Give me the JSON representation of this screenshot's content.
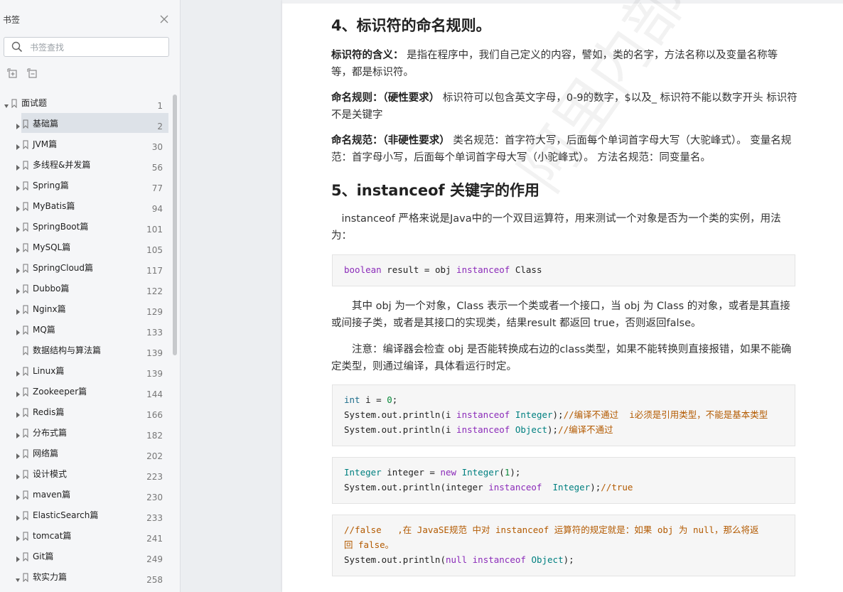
{
  "sidebar": {
    "title": "书签",
    "search": {
      "placeholder": "书签查找",
      "value": ""
    },
    "tree": [
      {
        "label": "面试题",
        "page": "1",
        "level": 0,
        "arrow": "expanded",
        "selected": false
      },
      {
        "label": "基础篇",
        "page": "2",
        "level": 1,
        "arrow": "collapsed",
        "selected": true
      },
      {
        "label": "JVM篇",
        "page": "30",
        "level": 1,
        "arrow": "collapsed",
        "selected": false
      },
      {
        "label": "多线程&并发篇",
        "page": "56",
        "level": 1,
        "arrow": "collapsed",
        "selected": false
      },
      {
        "label": "Spring篇",
        "page": "77",
        "level": 1,
        "arrow": "collapsed",
        "selected": false
      },
      {
        "label": "MyBatis篇",
        "page": "94",
        "level": 1,
        "arrow": "collapsed",
        "selected": false
      },
      {
        "label": "SpringBoot篇",
        "page": "101",
        "level": 1,
        "arrow": "collapsed",
        "selected": false
      },
      {
        "label": "MySQL篇",
        "page": "105",
        "level": 1,
        "arrow": "collapsed",
        "selected": false
      },
      {
        "label": "SpringCloud篇",
        "page": "117",
        "level": 1,
        "arrow": "collapsed",
        "selected": false
      },
      {
        "label": "Dubbo篇",
        "page": "122",
        "level": 1,
        "arrow": "collapsed",
        "selected": false
      },
      {
        "label": "Nginx篇",
        "page": "129",
        "level": 1,
        "arrow": "collapsed",
        "selected": false
      },
      {
        "label": "MQ篇",
        "page": "133",
        "level": 1,
        "arrow": "collapsed",
        "selected": false
      },
      {
        "label": "数据结构与算法篇",
        "page": "139",
        "level": 1,
        "arrow": "none",
        "selected": false
      },
      {
        "label": "Linux篇",
        "page": "139",
        "level": 1,
        "arrow": "collapsed",
        "selected": false
      },
      {
        "label": "Zookeeper篇",
        "page": "144",
        "level": 1,
        "arrow": "collapsed",
        "selected": false
      },
      {
        "label": "Redis篇",
        "page": "166",
        "level": 1,
        "arrow": "collapsed",
        "selected": false
      },
      {
        "label": "分布式篇",
        "page": "182",
        "level": 1,
        "arrow": "collapsed",
        "selected": false
      },
      {
        "label": "网络篇",
        "page": "202",
        "level": 1,
        "arrow": "collapsed",
        "selected": false
      },
      {
        "label": "设计模式",
        "page": "223",
        "level": 1,
        "arrow": "collapsed",
        "selected": false
      },
      {
        "label": "maven篇",
        "page": "230",
        "level": 1,
        "arrow": "collapsed",
        "selected": false
      },
      {
        "label": "ElasticSearch篇",
        "page": "233",
        "level": 1,
        "arrow": "collapsed",
        "selected": false
      },
      {
        "label": "tomcat篇",
        "page": "241",
        "level": 1,
        "arrow": "collapsed",
        "selected": false
      },
      {
        "label": "Git篇",
        "page": "249",
        "level": 1,
        "arrow": "collapsed",
        "selected": false
      },
      {
        "label": "软实力篇",
        "page": "258",
        "level": 1,
        "arrow": "expanded",
        "selected": false
      }
    ]
  },
  "doc": {
    "h4": "4、标识符的命名规则。",
    "p1_bold": "标识符的含义：",
    "p1_text": " 是指在程序中，我们自己定义的内容，譬如，类的名字，方法名称以及变量名称等等，都是标识符。",
    "p2_bold": "命名规则：（硬性要求）",
    "p2_text": " 标识符可以包含英文字母，0-9的数字，$以及_ 标识符不能以数字开头 标识符不是关键字",
    "p3_bold": "命名规范：（非硬性要求）",
    "p3_text": " 类名规范：首字符大写，后面每个单词首字母大写（大驼峰式）。 变量名规范：首字母小写，后面每个单词首字母大写（小驼峰式）。 方法名规范：同变量名。",
    "h5": "5、instanceof 关键字的作用",
    "p4": "　instanceof 严格来说是Java中的一个双目运算符，用来测试一个对象是否为一个类的实例，用法为：",
    "code1": {
      "a": "boolean",
      "b": " result = obj ",
      "c": "instanceof",
      "d": " Class"
    },
    "p5": "　　其中 obj 为一个对象，Class 表示一个类或者一个接口，当 obj 为 Class 的对象，或者是其直接或间接子类，或者是其接口的实现类，结果result 都返回 true，否则返回false。",
    "p6": "　　注意：编译器会检查 obj 是否能转换成右边的class类型，如果不能转换则直接报错，如果不能确定类型，则通过编译，具体看运行时定。",
    "code2": {
      "l1a": "int",
      "l1b": " i = ",
      "l1c": "0",
      "l1d": ";",
      "l2a": "System.out.println(i ",
      "l2b": "instanceof",
      "l2c": " ",
      "l2d": "Integer",
      "l2e": ");",
      "l2f": "//编译不通过  i必须是引用类型，不能是基本类型",
      "l3a": "System.out.println(i ",
      "l3b": "instanceof",
      "l3c": " ",
      "l3d": "Object",
      "l3e": ");",
      "l3f": "//编译不通过"
    },
    "code3": {
      "l1a": "Integer",
      "l1b": " integer = ",
      "l1c": "new",
      "l1d": " ",
      "l1e": "Integer",
      "l1f": "(",
      "l1g": "1",
      "l1h": ");",
      "l2a": "System.out.println(integer ",
      "l2b": "instanceof",
      "l2c": "  ",
      "l2d": "Integer",
      "l2e": ");",
      "l2f": "//true"
    },
    "code4": {
      "l1": "//false   ,在 JavaSE规范 中对 instanceof 运算符的规定就是：如果 obj 为 null，那么将返",
      "l2": "回 false。",
      "l3a": "System.out.println(",
      "l3b": "null",
      "l3c": " ",
      "l3d": "instanceof",
      "l3e": " ",
      "l3f": "Object",
      "l3g": ");"
    },
    "watermark": "阿里内部资料"
  },
  "colors": {
    "keyword": "#8b2bb9",
    "type": "#008080",
    "comment": "#b35a00",
    "number": "#0a8a3a",
    "selected_row": "#dde2e8"
  }
}
